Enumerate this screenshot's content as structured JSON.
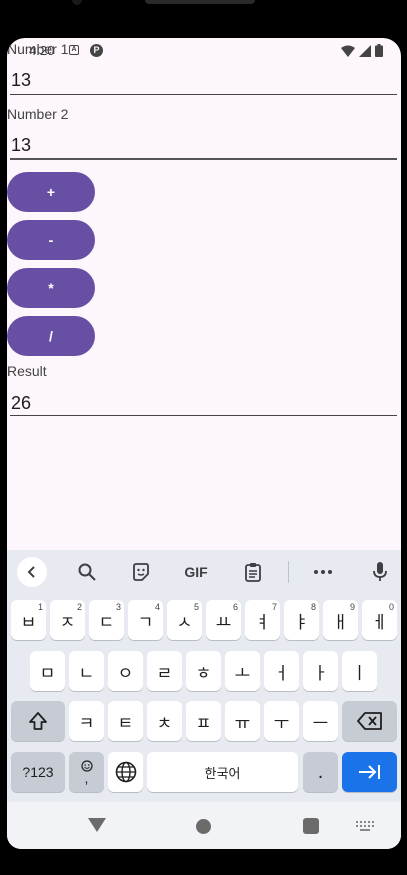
{
  "status": {
    "time": "4:20"
  },
  "form": {
    "number1_label": "Number 1",
    "number1_value": "13",
    "number2_label": "Number 2",
    "number2_value": "13",
    "buttons": {
      "add": "+",
      "subtract": "-",
      "multiply": "*",
      "divide": "/"
    },
    "result_label": "Result",
    "result_value": "26"
  },
  "keyboard": {
    "toolbar": {
      "gif_label": "GIF"
    },
    "row1": [
      {
        "char": "ㅂ",
        "hint": "1"
      },
      {
        "char": "ㅈ",
        "hint": "2"
      },
      {
        "char": "ㄷ",
        "hint": "3"
      },
      {
        "char": "ㄱ",
        "hint": "4"
      },
      {
        "char": "ㅅ",
        "hint": "5"
      },
      {
        "char": "ㅛ",
        "hint": "6"
      },
      {
        "char": "ㅕ",
        "hint": "7"
      },
      {
        "char": "ㅑ",
        "hint": "8"
      },
      {
        "char": "ㅐ",
        "hint": "9"
      },
      {
        "char": "ㅔ",
        "hint": "0"
      }
    ],
    "row2": [
      "ㅁ",
      "ㄴ",
      "ㅇ",
      "ㄹ",
      "ㅎ",
      "ㅗ",
      "ㅓ",
      "ㅏ",
      "ㅣ"
    ],
    "row3": [
      "ㅋ",
      "ㅌ",
      "ㅊ",
      "ㅍ",
      "ㅠ",
      "ㅜ",
      "ㅡ"
    ],
    "symbols_label": "?123",
    "emoji_comma": ",",
    "space_label": "한국어",
    "period_label": "."
  },
  "colors": {
    "accent": "#6750a4",
    "background": "#fdf6fd",
    "keyboard_bg": "#e7eaf1",
    "enter_key": "#1a73e8"
  }
}
